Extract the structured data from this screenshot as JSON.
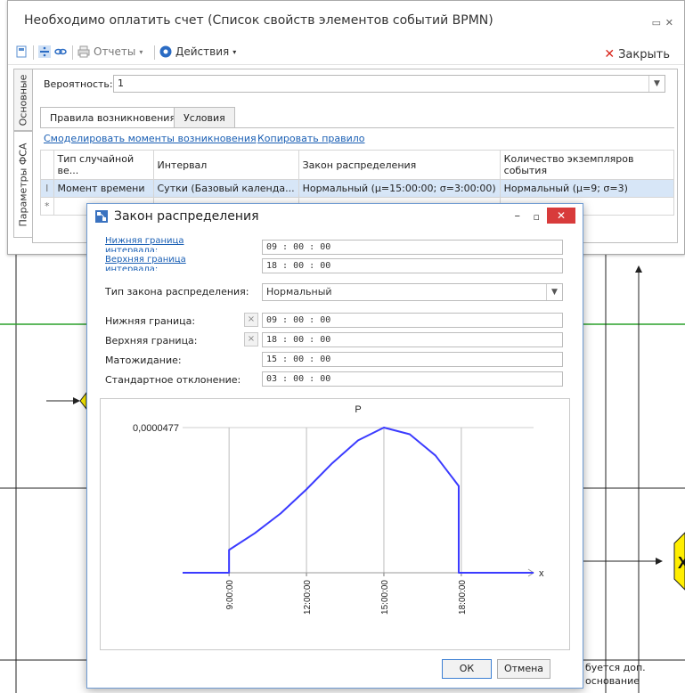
{
  "window": {
    "title": "Необходимо оплатить счет (Список свойств элементов событий BPMN)",
    "restore_icon": "restore-icon",
    "close_icon": "close-icon"
  },
  "toolbar": {
    "reports_label": "Отчеты",
    "actions_label": "Действия",
    "close_label": "Закрыть"
  },
  "side_tabs": {
    "main": "Основные",
    "fsa": "Параметры ФСА"
  },
  "probability": {
    "label": "Вероятность:",
    "value": "1"
  },
  "tabs": {
    "rules": "Правила возникновения",
    "conditions": "Условия"
  },
  "links": {
    "simulate": "Смоделировать моменты возникновения",
    "copy_rule": "Копировать правило"
  },
  "table": {
    "headers": [
      "Тип случайной ве...",
      "Интервал",
      "Закон распределения",
      "Количество экземпляров события"
    ],
    "rows": [
      {
        "indicator": "I",
        "cells": [
          "Момент времени",
          "Сутки (Базовый календа...",
          "Нормальный (μ=15:00:00; σ=3:00:00)",
          "Нормальный (μ=9; σ=3)"
        ]
      }
    ],
    "new_row_indicator": "*"
  },
  "dialog": {
    "title": "Закон распределения",
    "fields": {
      "lower_bound_interval_label": "Нижняя граница интервала:",
      "lower_bound_interval_value": "09 : 00 : 00",
      "upper_bound_interval_label": "Верхняя граница интервала:",
      "upper_bound_interval_value": "18 : 00 : 00",
      "law_type_label": "Тип закона распределения:",
      "law_type_value": "Нормальный",
      "lower_bound_label": "Нижняя граница:",
      "lower_bound_value": "09 : 00 : 00",
      "upper_bound_label": "Верхняя граница:",
      "upper_bound_value": "18 : 00 : 00",
      "mean_label": "Матожидание:",
      "mean_value": "15 : 00 : 00",
      "std_label": "Стандартное отклонение:",
      "std_value": "03 : 00 : 00",
      "clear_glyph": "×"
    },
    "ok_label": "ОК",
    "cancel_label": "Отмена"
  },
  "background_labels": {
    "note_line1": "буется доп.",
    "note_line2": "основание"
  },
  "chart_data": {
    "type": "line",
    "title": "P",
    "xlabel": "x",
    "ylabel": "",
    "ymax_label": "0,0000477",
    "x_ticks": [
      "9:00:00",
      "12:00:00",
      "15:00:00",
      "18:00:00"
    ],
    "x_tick_hours": [
      9,
      12,
      15,
      18
    ],
    "xlim_hours": [
      7.2,
      20.8
    ],
    "ylim": [
      0,
      4.77e-05
    ],
    "curve": [
      {
        "x": 7.2,
        "y": 0
      },
      {
        "x": 9,
        "y": 0
      },
      {
        "x": 9,
        "y": 7.5e-06
      },
      {
        "x": 10,
        "y": 1.3e-05
      },
      {
        "x": 11,
        "y": 1.95e-05
      },
      {
        "x": 12,
        "y": 2.74e-05
      },
      {
        "x": 13,
        "y": 3.6e-05
      },
      {
        "x": 14,
        "y": 4.35e-05
      },
      {
        "x": 15,
        "y": 4.77e-05
      },
      {
        "x": 16,
        "y": 4.55e-05
      },
      {
        "x": 17,
        "y": 3.85e-05
      },
      {
        "x": 17.9,
        "y": 2.85e-05
      },
      {
        "x": 17.9,
        "y": 0
      },
      {
        "x": 20.8,
        "y": 0
      }
    ],
    "line_color": "#3b3bff",
    "grid": true
  }
}
